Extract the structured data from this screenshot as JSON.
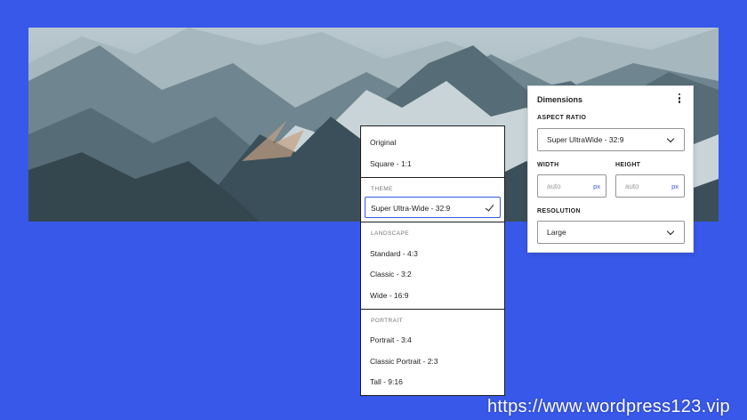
{
  "dimensions_panel": {
    "title": "Dimensions",
    "aspect_ratio_label": "ASPECT RATIO",
    "aspect_ratio_value": "Super UltraWide - 32:9",
    "width_label": "WIDTH",
    "height_label": "HEIGHT",
    "width_placeholder": "auto",
    "height_placeholder": "auto",
    "unit": "px",
    "resolution_label": "RESOLUTION",
    "resolution_value": "Large"
  },
  "aspect_menu": {
    "items_top": [
      "Original",
      "Square - 1:1"
    ],
    "theme_header": "THEME",
    "theme_selected": "Super Ultra-Wide - 32:9",
    "landscape_header": "LANDSCAPE",
    "landscape_items": [
      "Standard - 4:3",
      "Classic - 3:2",
      "Wide - 16:9"
    ],
    "portrait_header": "PORTRAIT",
    "portrait_items": [
      "Portrait - 3:4",
      "Classic Portrait - 2:3",
      "Tall - 9:16"
    ]
  },
  "watermark": "https://www.wordpress123.vip",
  "colors": {
    "background": "#3858e9",
    "accent": "#3858e9"
  }
}
